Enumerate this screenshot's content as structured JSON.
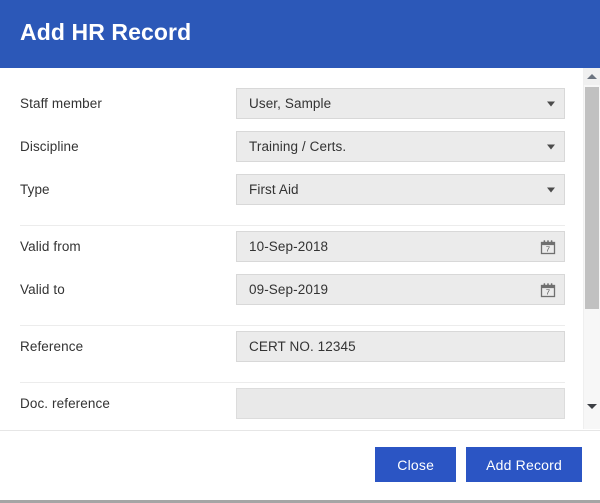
{
  "dialog": {
    "title": "Add HR Record"
  },
  "form": {
    "rows": [
      {
        "label": "Staff member",
        "value": "User, Sample",
        "control": "select",
        "icon": "chevron-down-icon",
        "name": "staff-member"
      },
      {
        "label": "Discipline",
        "value": "Training / Certs.",
        "control": "select",
        "icon": "chevron-down-icon",
        "name": "discipline"
      },
      {
        "label": "Type",
        "value": "First Aid",
        "control": "select",
        "icon": "chevron-down-icon",
        "name": "type"
      },
      {
        "label": "Valid from",
        "value": "10-Sep-2018",
        "control": "date",
        "icon": "calendar-icon",
        "name": "valid-from"
      },
      {
        "label": "Valid to",
        "value": "09-Sep-2019",
        "control": "date",
        "icon": "calendar-icon",
        "name": "valid-to"
      },
      {
        "label": "Reference",
        "value": "CERT NO. 12345",
        "control": "text",
        "icon": "none",
        "name": "reference"
      },
      {
        "label": "Doc. reference",
        "value": "",
        "control": "text",
        "icon": "none",
        "name": "doc-reference"
      }
    ]
  },
  "footer": {
    "close_label": "Close",
    "submit_label": "Add Record"
  },
  "scrollbar": {
    "up_arrow": "scroll-up-arrow-icon",
    "down_arrow": "scroll-down-arrow-icon"
  },
  "colors": {
    "header_blue": "#2c58b8",
    "button_blue": "#2b55c4",
    "field_gray": "#ebebeb",
    "label_text": "#333333"
  }
}
